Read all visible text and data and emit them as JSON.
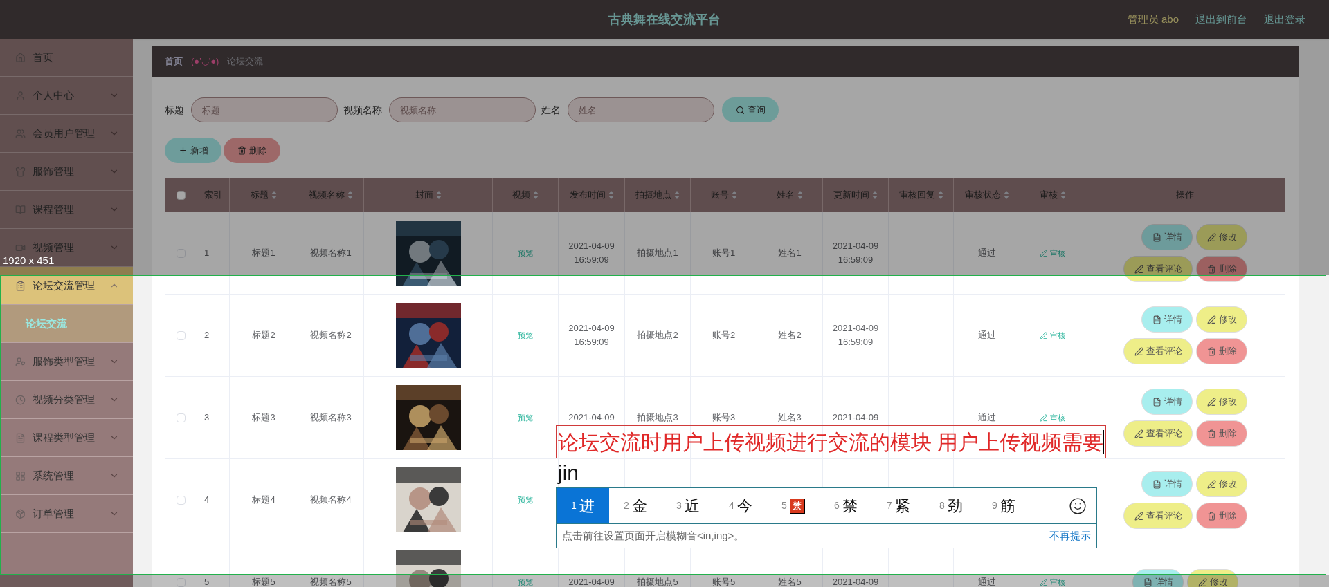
{
  "header": {
    "title": "古典舞在线交流平台",
    "user": "管理员 abo",
    "links": [
      "退出到前台",
      "退出登录"
    ]
  },
  "sidebar": {
    "items": [
      {
        "label": "首页",
        "kind": "link"
      },
      {
        "label": "个人中心",
        "kind": "menu",
        "expanded": false
      },
      {
        "label": "会员用户管理",
        "kind": "menu",
        "expanded": false
      },
      {
        "label": "服饰管理",
        "kind": "menu",
        "expanded": false
      },
      {
        "label": "课程管理",
        "kind": "menu",
        "expanded": false
      },
      {
        "label": "视频管理",
        "kind": "menu",
        "expanded": false
      },
      {
        "label": "论坛交流管理",
        "kind": "menu",
        "expanded": true,
        "children": [
          {
            "label": "论坛交流",
            "selected": true
          }
        ]
      },
      {
        "label": "服饰类型管理",
        "kind": "menu",
        "expanded": false
      },
      {
        "label": "视频分类管理",
        "kind": "menu",
        "expanded": false
      },
      {
        "label": "课程类型管理",
        "kind": "menu",
        "expanded": false
      },
      {
        "label": "系统管理",
        "kind": "menu",
        "expanded": false
      },
      {
        "label": "订单管理",
        "kind": "menu",
        "expanded": false
      }
    ]
  },
  "breadcrumb": {
    "home": "首页",
    "emoticon": "(●'◡'●)",
    "current": "论坛交流"
  },
  "search": {
    "fields": [
      {
        "label": "标题",
        "placeholder": "标题"
      },
      {
        "label": "视频名称",
        "placeholder": "视频名称"
      },
      {
        "label": "姓名",
        "placeholder": "姓名"
      }
    ],
    "button": "查询"
  },
  "toolbar": [
    {
      "label": "新增",
      "kind": "add"
    },
    {
      "label": "删除",
      "kind": "delete"
    }
  ],
  "table": {
    "select_all": {
      "checked": false
    },
    "columns": [
      {
        "label": "索引",
        "sortable": false
      },
      {
        "label": "标题",
        "sortable": true
      },
      {
        "label": "视频名称",
        "sortable": true
      },
      {
        "label": "封面",
        "sortable": true
      },
      {
        "label": "视频",
        "sortable": true
      },
      {
        "label": "发布时间",
        "sortable": true
      },
      {
        "label": "拍摄地点",
        "sortable": true
      },
      {
        "label": "账号",
        "sortable": true
      },
      {
        "label": "姓名",
        "sortable": true
      },
      {
        "label": "更新时间",
        "sortable": true
      },
      {
        "label": "审核回复",
        "sortable": true
      },
      {
        "label": "审核状态",
        "sortable": true
      },
      {
        "label": "审核",
        "sortable": true
      },
      {
        "label": "操作",
        "sortable": false
      }
    ],
    "rows": [
      {
        "checked": false,
        "index": "1",
        "title": "标题1",
        "video_name": "视频名称1",
        "video": "预览",
        "published": [
          "2021-04-09",
          "16:59:09"
        ],
        "location": "拍摄地点1",
        "account": "账号1",
        "name": "姓名1",
        "updated": [
          "2021-04-09",
          "16:59:09"
        ],
        "status": "通过",
        "review": "审核",
        "actions": [
          {
            "label": "详情",
            "kind": "detail"
          },
          {
            "label": "修改",
            "kind": "edit"
          },
          {
            "label": "查看评论",
            "kind": "comments"
          },
          {
            "label": "删除",
            "kind": "delete"
          }
        ]
      },
      {
        "checked": false,
        "index": "2",
        "title": "标题2",
        "video_name": "视频名称2",
        "video": "预览",
        "published": [
          "2021-04-09",
          "16:59:09"
        ],
        "location": "拍摄地点2",
        "account": "账号2",
        "name": "姓名2",
        "updated": [
          "2021-04-09",
          "16:59:09"
        ],
        "status": "通过",
        "review": "审核",
        "actions": [
          {
            "label": "详情",
            "kind": "detail"
          },
          {
            "label": "修改",
            "kind": "edit"
          },
          {
            "label": "查看评论",
            "kind": "comments"
          },
          {
            "label": "删除",
            "kind": "delete"
          }
        ]
      },
      {
        "checked": false,
        "index": "3",
        "title": "标题3",
        "video_name": "视频名称3",
        "video": "预览",
        "published": [
          "2021-04-09"
        ],
        "location": "拍摄地点3",
        "account": "账号3",
        "name": "姓名3",
        "updated": [
          "2021-04-09"
        ],
        "status": "通过",
        "review": "审核",
        "actions": [
          {
            "label": "详情",
            "kind": "detail"
          },
          {
            "label": "修改",
            "kind": "edit"
          },
          {
            "label": "查看评论",
            "kind": "comments"
          },
          {
            "label": "删除",
            "kind": "delete"
          }
        ]
      },
      {
        "checked": false,
        "index": "4",
        "title": "标题4",
        "video_name": "视频名称4",
        "video": "预览",
        "actions": [
          {
            "label": "详情",
            "kind": "detail"
          },
          {
            "label": "修改",
            "kind": "edit"
          },
          {
            "label": "查看评论",
            "kind": "comments"
          },
          {
            "label": "删除",
            "kind": "delete"
          }
        ]
      },
      {
        "checked": false,
        "index": "5",
        "title": "标题5",
        "video_name": "视频名称5",
        "video": "预览",
        "published": [
          "2021-04-09"
        ],
        "location": "拍摄地点5",
        "account": "账号5",
        "name": "姓名5",
        "updated": [
          "2021-04-09"
        ],
        "status": "通过",
        "review": "审核",
        "actions": [
          {
            "label": "详情",
            "kind": "detail"
          },
          {
            "label": "修改",
            "kind": "edit"
          }
        ]
      }
    ]
  },
  "screenshot_tool": {
    "size_label": "1920 x 451"
  },
  "annotation": {
    "text": "论坛交流时用户上传视频进行交流的模块 用户上传视频需要"
  },
  "ime": {
    "composition": "jin",
    "candidates": [
      {
        "number": "1",
        "text": "进",
        "kind": "char",
        "selected": true
      },
      {
        "number": "2",
        "text": "金",
        "kind": "char",
        "selected": false
      },
      {
        "number": "3",
        "text": "近",
        "kind": "char",
        "selected": false
      },
      {
        "number": "4",
        "text": "今",
        "kind": "char",
        "selected": false
      },
      {
        "number": "5",
        "text": "禁",
        "kind": "sticker",
        "selected": false
      },
      {
        "number": "6",
        "text": "禁",
        "kind": "char",
        "selected": false
      },
      {
        "number": "7",
        "text": "紧",
        "kind": "char",
        "selected": false
      },
      {
        "number": "8",
        "text": "劲",
        "kind": "char",
        "selected": false
      },
      {
        "number": "9",
        "text": "筋",
        "kind": "char",
        "selected": false
      }
    ],
    "hint": "点击前往设置页面开启模糊音<in,ing>。",
    "dismiss": "不再提示"
  }
}
